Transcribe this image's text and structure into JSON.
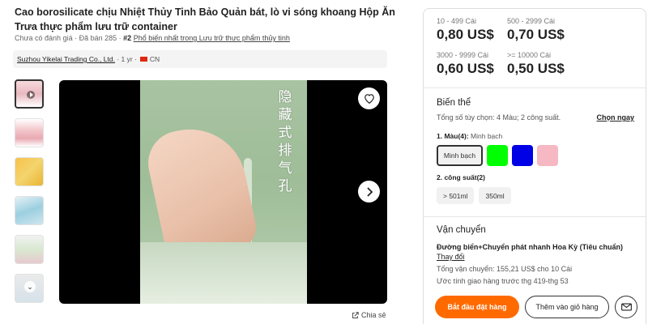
{
  "product": {
    "title": "Cao borosilicate chịu Nhiệt Thủy Tinh Bảo Quản bát, lò vi sóng khoang Hộp Ăn Trưa thực phẩm lưu trữ container",
    "rating_text": "Chưa có đánh giá",
    "sold_text": "Đã bán 285",
    "rank_badge": "#2",
    "rank_text": "Phổ biến nhất trong Lưu trữ thực phẩm thủy tinh"
  },
  "supplier": {
    "name": "Suzhou Yikelai Trading Co., Ltd.",
    "years": "1 yr",
    "country": "CN"
  },
  "gallery": {
    "thumbnails": [
      "thumb-1",
      "thumb-2",
      "thumb-3",
      "thumb-4",
      "thumb-5",
      "thumb-6"
    ],
    "active_index": 0,
    "overlay_text": "隐藏式排气孔",
    "share_label": "Chia sẻ"
  },
  "pricing": {
    "tiers": [
      {
        "qty": "10 - 499 Cái",
        "price": "0,80 US$"
      },
      {
        "qty": "500 - 2999 Cái",
        "price": "0,70 US$"
      },
      {
        "qty": "3000 - 9999 Cái",
        "price": "0,60 US$"
      },
      {
        "qty": ">= 10000 Cái",
        "price": "0,50 US$"
      }
    ]
  },
  "variants": {
    "title": "Biến thể",
    "summary": "Tổng số tùy chọn: 4 Màu; 2 công suất.",
    "select_now": "Chọn ngay",
    "color_label": "1. Màu(4):",
    "color_selected": "Minh bạch",
    "color_options": [
      {
        "label": "Minh bạch",
        "color": "#f1f1f1"
      },
      {
        "label": "",
        "color": "#00ff00"
      },
      {
        "label": "",
        "color": "#0000e6"
      },
      {
        "label": "",
        "color": "#f6b9c4"
      }
    ],
    "capacity_label": "2. công suất(2)",
    "capacity_options": [
      "> 501ml",
      "350ml"
    ]
  },
  "shipping": {
    "title": "Vận chuyển",
    "method": "Đường biển+Chuyển phát nhanh Hoa Kỳ (Tiêu chuẩn)",
    "change_label": "Thay đổi",
    "total_cost": "Tổng vận chuyển: 155,21 US$ cho 10 Cái",
    "delivery_estimate": "Ước tính giao hàng trước thg 419-thg 53"
  },
  "actions": {
    "order_label": "Bắt đầu đặt hàng",
    "cart_label": "Thêm vào giỏ hàng"
  },
  "colors": {
    "accent": "#ff6a00",
    "china_flag": "#de2910"
  }
}
